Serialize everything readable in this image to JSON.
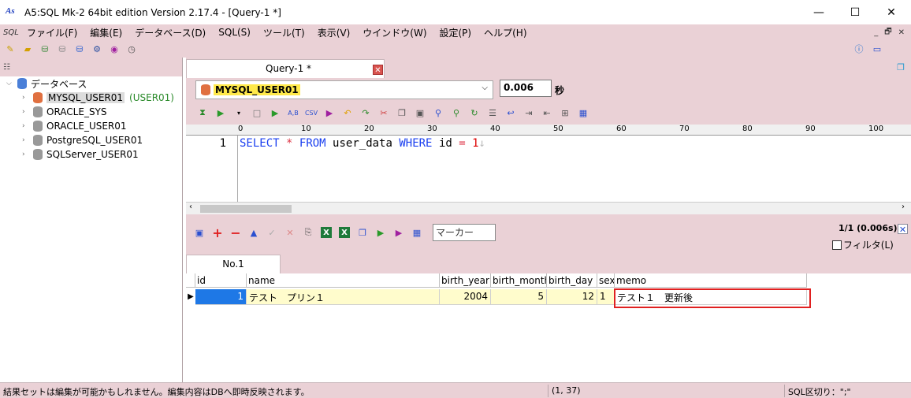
{
  "window": {
    "title": "A5:SQL Mk-2 64bit edition Version 2.17.4 - [Query-1 *]",
    "min_glyph": "—",
    "max_glyph": "☐",
    "close_glyph": "✕"
  },
  "menu": {
    "sql_icon_text": "SQL",
    "items": [
      "ファイル(F)",
      "編集(E)",
      "データベース(D)",
      "SQL(S)",
      "ツール(T)",
      "表示(V)",
      "ウインドウ(W)",
      "設定(P)",
      "ヘルプ(H)"
    ],
    "mdi": [
      "_",
      "🗗",
      "✕"
    ]
  },
  "tree": {
    "root": "データベース",
    "items": [
      {
        "label": "MYSQL_USER01",
        "note": "(USER01)",
        "selected": true
      },
      {
        "label": "ORACLE_SYS",
        "note": ""
      },
      {
        "label": "ORACLE_USER01",
        "note": ""
      },
      {
        "label": "PostgreSQL_USER01",
        "note": ""
      },
      {
        "label": "SQLServer_USER01",
        "note": ""
      }
    ]
  },
  "query": {
    "tab_label": "Query-1 *",
    "tab_close": "✕",
    "connection": "MYSQL_USER01",
    "exec_time": "0.006",
    "sec_label": "秒",
    "ruler": [
      "0",
      "10",
      "20",
      "30",
      "40",
      "50",
      "60",
      "70",
      "80",
      "90",
      "100"
    ],
    "line_number": "1",
    "sql": {
      "kw1": "SELECT",
      "star": "*",
      "kw2": "FROM",
      "table": "user_data",
      "kw3": "WHERE",
      "col": "id",
      "eq": "=",
      "val": "1",
      "eol": "↓"
    }
  },
  "results": {
    "marker_placeholder": "マーカー",
    "count": "1/1 (0.006s)",
    "close_glyph": "✕",
    "filter_label": "フィルタ(L)",
    "tab_label": "No.1",
    "columns": [
      "id",
      "name",
      "birth_year",
      "birth_month",
      "birth_day",
      "sex",
      "memo"
    ],
    "rows": [
      {
        "id": "1",
        "name": "テスト　プリン１",
        "birth_year": "2004",
        "birth_month": "5",
        "birth_day": "12",
        "sex": "1",
        "memo": "テスト１　更新後"
      }
    ]
  },
  "status": {
    "message": "結果セットは編集が可能かもしれません。編集内容はDBへ即時反映されます。",
    "cursor": "(1, 37)",
    "delimiter": "SQL区切り：\";\""
  },
  "colors": {
    "panel": "#ead1d6",
    "selection": "#1e78e6",
    "highlight": "#e02020",
    "keyword": "#1a3ff0"
  }
}
